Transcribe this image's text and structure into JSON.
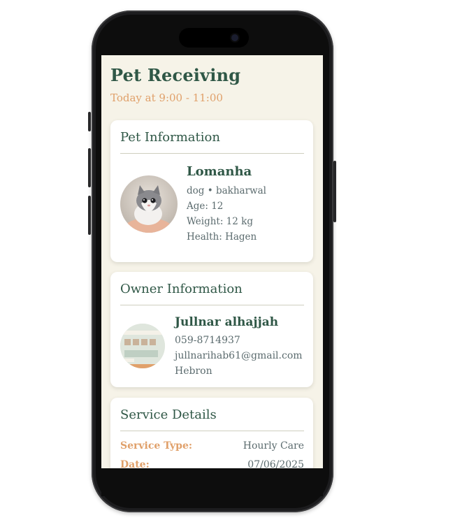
{
  "header": {
    "title": "Pet Receiving",
    "subtitle": "Today at 9:00 - 11:00"
  },
  "pet_card": {
    "title": "Pet Information",
    "name": "Lomanha",
    "type_breed": "dog • bakharwal",
    "age": "Age: 12",
    "weight": "Weight: 12 kg",
    "health": "Health: Hagen"
  },
  "owner_card": {
    "title": "Owner Information",
    "name": "Jullnar alhajjah",
    "phone": "059-8714937",
    "email": "jullnarihab61@gmail.com",
    "city": "Hebron"
  },
  "service_card": {
    "title": "Service Details",
    "rows": [
      {
        "label": "Service Type:",
        "value": "Hourly Care"
      },
      {
        "label": "Date:",
        "value": "07/06/2025"
      }
    ]
  },
  "colors": {
    "primary_green": "#2f5746",
    "accent_orange": "#e0a06a",
    "background": "#f6f3e8",
    "text_muted": "#5b6b6e"
  },
  "icons": {
    "pet_photo": "kitten-photo",
    "owner_photo": "app-screenshot-thumbnail"
  }
}
